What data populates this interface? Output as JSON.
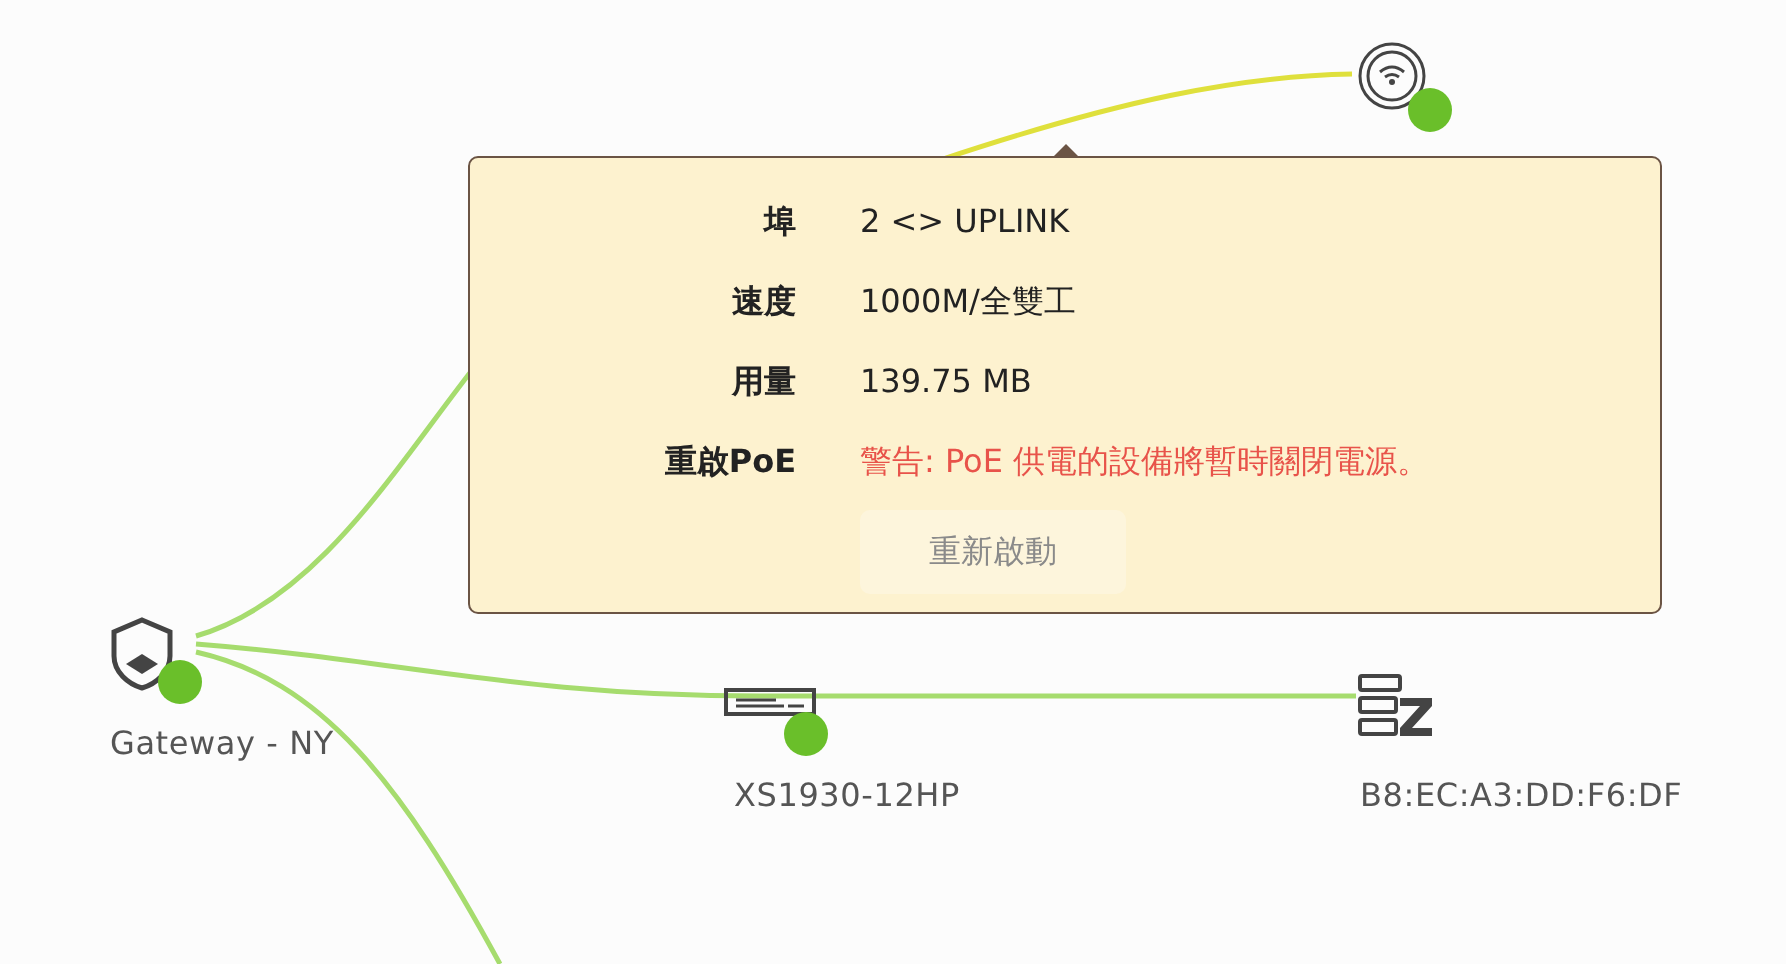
{
  "links": [
    {
      "color": "#a6dc6e"
    },
    {
      "color": "#dfe03c"
    },
    {
      "color": "#a6dc6e"
    },
    {
      "color": "#a6dc6e"
    }
  ],
  "nodes": [
    {
      "kind": "gateway",
      "label": "Gateway - NY",
      "color": "#6abf2a"
    },
    {
      "kind": "switch",
      "label": "XS1930-12HP",
      "color": "#6abf2a"
    },
    {
      "kind": "server",
      "label": "B8:EC:A3:DD:F6:DF"
    },
    {
      "kind": "access-point",
      "color": "#6abf2a"
    }
  ],
  "tooltip": {
    "rows": [
      {
        "kind": "text",
        "label": "埠",
        "value": "2 <> UPLINK"
      },
      {
        "kind": "text",
        "label": "速度",
        "value": "1000M/全雙工"
      },
      {
        "kind": "text",
        "label": "用量",
        "value": "139.75 MB"
      },
      {
        "kind": "warning",
        "label": "重啟PoE",
        "value": "警告: PoE 供電的設備將暫時關閉電源。"
      }
    ],
    "button": {
      "label": "重新啟動",
      "disabled": true
    }
  }
}
